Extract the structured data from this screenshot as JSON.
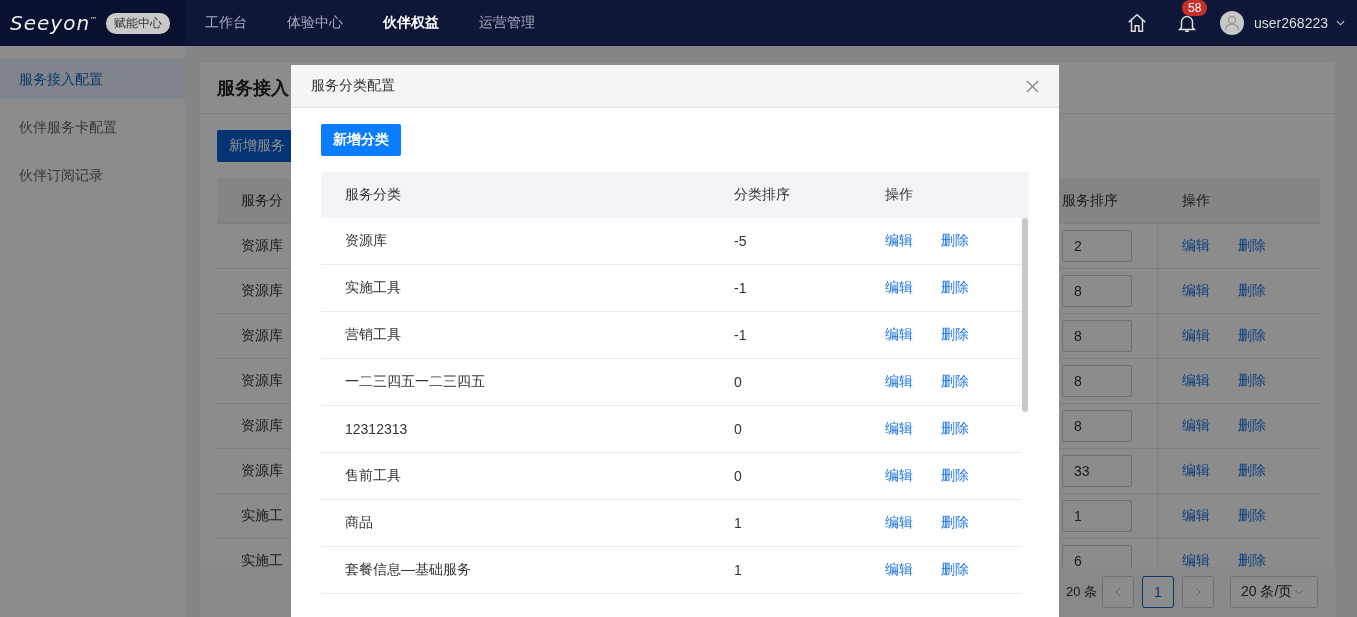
{
  "top_bar": {
    "logo": "Seeyon",
    "logo_mark": "™",
    "badge": "赋能中心",
    "nav": [
      {
        "label": "工作台",
        "selected": false
      },
      {
        "label": "体验中心",
        "selected": false
      },
      {
        "label": "伙伴权益",
        "selected": true
      },
      {
        "label": "运营管理",
        "selected": false
      }
    ],
    "notification_count": "58",
    "username": "user268223"
  },
  "sidebar": {
    "items": [
      {
        "label": "服务接入配置",
        "selected": true
      },
      {
        "label": "伙伴服务卡配置",
        "selected": false
      },
      {
        "label": "伙伴订阅记录",
        "selected": false
      }
    ]
  },
  "page": {
    "title": "服务接入",
    "add_button": "新增服务",
    "table": {
      "columns": [
        "服务分",
        "服务排序",
        "操作"
      ],
      "rows": [
        {
          "category": "资源库",
          "order": "2",
          "actions": [
            "编辑",
            "删除"
          ]
        },
        {
          "category": "资源库",
          "order": "8",
          "actions": [
            "编辑",
            "删除"
          ]
        },
        {
          "category": "资源库",
          "order": "8",
          "actions": [
            "编辑",
            "删除"
          ]
        },
        {
          "category": "资源库",
          "order": "8",
          "actions": [
            "编辑",
            "删除"
          ]
        },
        {
          "category": "资源库",
          "order": "8",
          "actions": [
            "编辑",
            "删除"
          ]
        },
        {
          "category": "资源库",
          "order": "33",
          "actions": [
            "编辑",
            "删除"
          ]
        },
        {
          "category": "实施工",
          "order": "1",
          "actions": [
            "编辑",
            "删除"
          ]
        },
        {
          "category": "实施工",
          "order": "6",
          "actions": [
            "编辑",
            "删除"
          ]
        }
      ]
    },
    "pagination": {
      "total": "20 条",
      "pages": [
        {
          "label": "1",
          "selected": true
        }
      ],
      "page_size": "20 条/页"
    }
  },
  "dialog": {
    "title": "服务分类配置",
    "add_button": "新增分类",
    "table": {
      "columns": [
        "服务分类",
        "分类排序",
        "操作"
      ],
      "rows": [
        {
          "name": "资源库",
          "order": "-5",
          "actions": [
            "编辑",
            "删除"
          ]
        },
        {
          "name": "实施工具",
          "order": "-1",
          "actions": [
            "编辑",
            "删除"
          ]
        },
        {
          "name": "营销工具",
          "order": "-1",
          "actions": [
            "编辑",
            "删除"
          ]
        },
        {
          "name": "一二三四五一二三四五",
          "order": "0",
          "actions": [
            "编辑",
            "删除"
          ]
        },
        {
          "name": "12312313",
          "order": "0",
          "actions": [
            "编辑",
            "删除"
          ]
        },
        {
          "name": "售前工具",
          "order": "0",
          "actions": [
            "编辑",
            "删除"
          ]
        },
        {
          "name": "商品",
          "order": "1",
          "actions": [
            "编辑",
            "删除"
          ]
        },
        {
          "name": "套餐信息—基础服务",
          "order": "1",
          "actions": [
            "编辑",
            "删除"
          ]
        }
      ]
    }
  }
}
